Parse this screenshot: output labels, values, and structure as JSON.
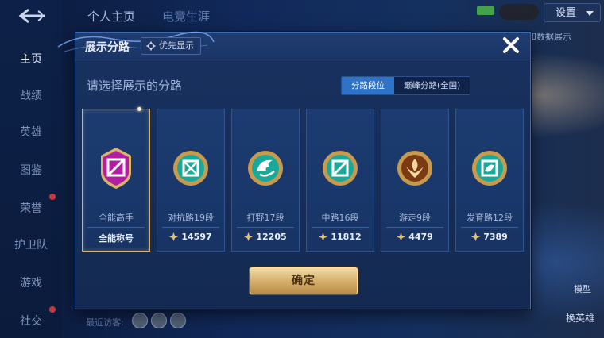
{
  "background": {
    "top_tabs": [
      "个人主页",
      "电竞生涯"
    ],
    "nav": [
      "主页",
      "战绩",
      "英雄",
      "图鉴",
      "荣誉",
      "护卫队",
      "游戏",
      "社交"
    ],
    "settings_label": "设置",
    "side_text": "和数据展示",
    "model_label": "模型",
    "switch_hero_label": "换英雄",
    "recent_visitors_label": "最近访客:"
  },
  "dialog": {
    "title": "展示分路",
    "priority_label": "优先显示",
    "subtitle": "请选择展示的分路",
    "tabs": [
      {
        "label": "分路段位",
        "active": true
      },
      {
        "label": "巅峰分路(全国)",
        "active": false
      }
    ],
    "confirm_label": "确定",
    "cards": [
      {
        "label": "全能高手",
        "footer": "全能称号",
        "score": null,
        "selected": true,
        "emblem": "purple-allround-emblem-icon"
      },
      {
        "label": "对抗路19段",
        "footer": "14597",
        "selected": false,
        "emblem": "clash-lane-emblem-icon"
      },
      {
        "label": "打野17段",
        "footer": "12205",
        "selected": false,
        "emblem": "jungle-emblem-icon"
      },
      {
        "label": "中路16段",
        "footer": "11812",
        "selected": false,
        "emblem": "mid-lane-emblem-icon"
      },
      {
        "label": "游走9段",
        "footer": "4479",
        "selected": false,
        "emblem": "roam-emblem-icon"
      },
      {
        "label": "发育路12段",
        "footer": "7389",
        "selected": false,
        "emblem": "farm-lane-emblem-icon"
      }
    ]
  },
  "colors": {
    "accent_blue": "#2f73c6",
    "gold": "#d9b16b",
    "dialog_bg": "#18315f"
  }
}
